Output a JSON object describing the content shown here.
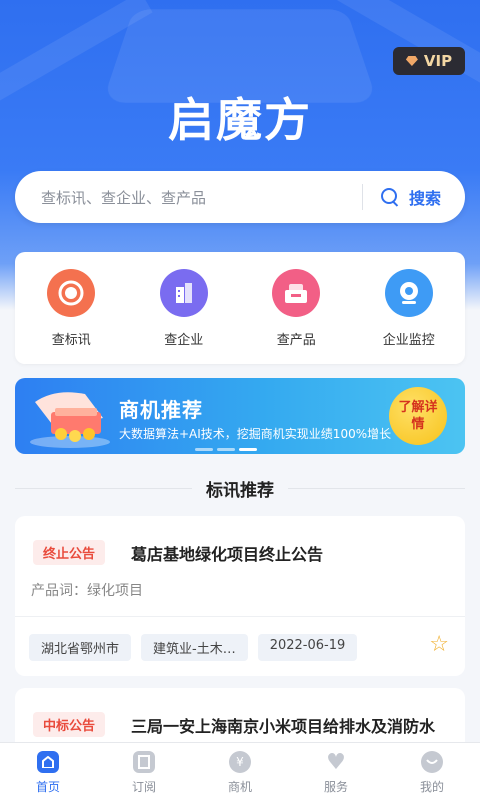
{
  "header": {
    "vip_label": "VIP",
    "app_title": "启魔方"
  },
  "search": {
    "placeholder": "查标讯、查企业、查产品",
    "button_label": "搜索"
  },
  "quick_actions": [
    {
      "label": "查标讯",
      "icon": "target-icon",
      "color": "#f4714f"
    },
    {
      "label": "查企业",
      "icon": "building-icon",
      "color": "#7a6cf0"
    },
    {
      "label": "查产品",
      "icon": "product-icon",
      "color": "#f25f86"
    },
    {
      "label": "企业监控",
      "icon": "camera-icon",
      "color": "#3e9bf5"
    }
  ],
  "banner": {
    "title": "商机推荐",
    "subtitle": "大数据算法+AI技术，挖掘商机实现业绩100%增长",
    "cta": "了解详情"
  },
  "section": {
    "title": "标讯推荐"
  },
  "notices": [
    {
      "tag": "终止公告",
      "title": "葛店基地绿化项目终止公告",
      "product_line": "产品词：绿化项目",
      "region": "湖北省鄂州市",
      "industry": "建筑业-土木…",
      "date": "2022-06-19"
    },
    {
      "tag": "中标公告",
      "title": "三局一安上海南京小米项目给排水及消防水"
    }
  ],
  "tabbar": [
    {
      "label": "首页",
      "icon": "home-icon",
      "active": true
    },
    {
      "label": "订阅",
      "icon": "subscribe-icon",
      "active": false
    },
    {
      "label": "商机",
      "icon": "yuan-icon",
      "active": false
    },
    {
      "label": "服务",
      "icon": "heart-icon",
      "active": false
    },
    {
      "label": "我的",
      "icon": "profile-icon",
      "active": false
    }
  ],
  "colors": {
    "primary": "#2f6ff0",
    "tag_red": "#e94b3c",
    "star": "#f0b030"
  }
}
